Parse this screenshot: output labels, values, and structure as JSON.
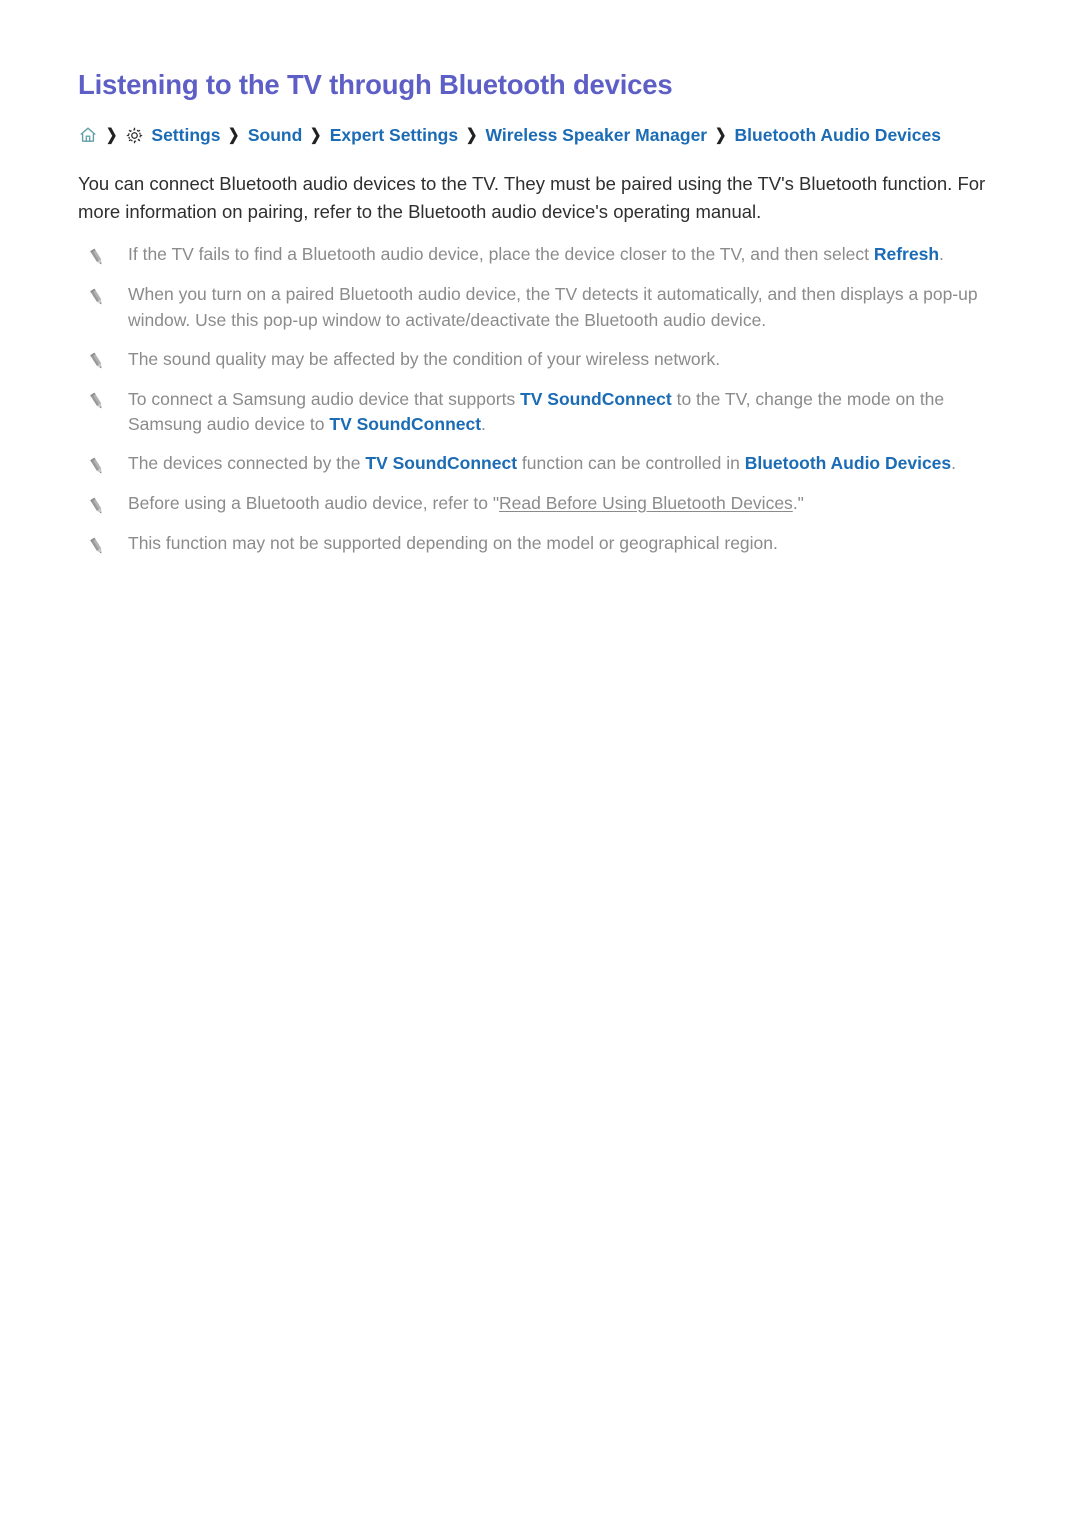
{
  "document": {
    "title": "Listening to the TV through Bluetooth devices"
  },
  "breadcrumb": {
    "name": "settings-path",
    "home_icon": "home-icon",
    "gear_icon": "gear-icon",
    "separator": "❯",
    "items": [
      {
        "label": "Settings",
        "icon": "gear-icon"
      },
      {
        "label": "Sound",
        "icon": ""
      },
      {
        "label": "Expert Settings",
        "icon": ""
      },
      {
        "label": "Wireless Speaker Manager",
        "icon": ""
      },
      {
        "label": "Bluetooth Audio Devices",
        "icon": ""
      }
    ]
  },
  "intro": {
    "text": "You can connect Bluetooth audio devices to the TV. They must be paired using the TV's Bluetooth function. For more information on pairing, refer to the Bluetooth audio device's operating manual."
  },
  "notes": {
    "bullet_icon": "pencil-icon",
    "items": [
      {
        "id": "note-refresh",
        "segments": [
          {
            "type": "text",
            "text": "If the TV fails to find a Bluetooth audio device, place the device closer to the TV, and then select "
          },
          {
            "type": "keyword",
            "text": "Refresh"
          },
          {
            "type": "text",
            "text": "."
          }
        ]
      },
      {
        "id": "note-popup",
        "segments": [
          {
            "type": "text",
            "text": "When you turn on a paired Bluetooth audio device, the TV detects it automatically, and then displays a pop-up window. Use this pop-up window to activate/deactivate the Bluetooth audio device."
          }
        ]
      },
      {
        "id": "note-sound-quality",
        "segments": [
          {
            "type": "text",
            "text": "The sound quality may be affected by the condition of your wireless network."
          }
        ]
      },
      {
        "id": "note-soundconnect-mode",
        "segments": [
          {
            "type": "text",
            "text": "To connect a Samsung audio device that supports "
          },
          {
            "type": "keyword",
            "text": "TV SoundConnect"
          },
          {
            "type": "text",
            "text": " to the TV, change the mode on the Samsung audio device to "
          },
          {
            "type": "keyword",
            "text": "TV SoundConnect"
          },
          {
            "type": "text",
            "text": "."
          }
        ]
      },
      {
        "id": "note-soundconnect-control",
        "segments": [
          {
            "type": "text",
            "text": "The devices connected by the "
          },
          {
            "type": "keyword",
            "text": "TV SoundConnect"
          },
          {
            "type": "text",
            "text": " function can be controlled in "
          },
          {
            "type": "keyword",
            "text": "Bluetooth Audio Devices"
          },
          {
            "type": "text",
            "text": "."
          }
        ]
      },
      {
        "id": "note-read-before",
        "segments": [
          {
            "type": "text",
            "text": "Before using a Bluetooth audio device, refer to \""
          },
          {
            "type": "link",
            "text": "Read Before Using Bluetooth Devices"
          },
          {
            "type": "text",
            "text": ".\""
          }
        ]
      },
      {
        "id": "note-model-region",
        "segments": [
          {
            "type": "text",
            "text": "This function may not be supported depending on the model or geographical region."
          }
        ]
      }
    ]
  },
  "colors": {
    "title": "#5d5fc6",
    "link": "#1b6cb5",
    "body": "#2f2f2f",
    "note": "#8b8b8b",
    "separator": "#222222",
    "home_icon": "#63a0a8",
    "pencil_icon": "#a8a8a8",
    "background": "#ffffff"
  }
}
